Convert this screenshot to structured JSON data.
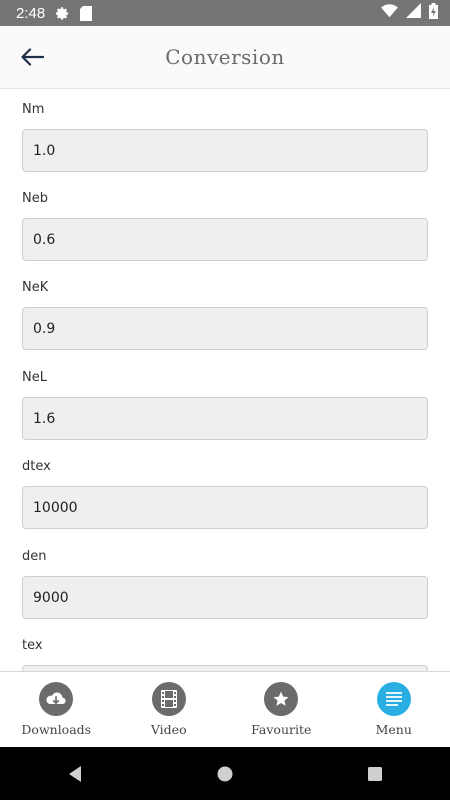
{
  "status_bar": {
    "time": "2:48",
    "icons": [
      "settings-gear-icon",
      "sd-card-icon",
      "wifi-icon",
      "signal-icon",
      "battery-charging-icon"
    ]
  },
  "header": {
    "title": "Conversion",
    "back_icon": "arrow-left-icon"
  },
  "fields": [
    {
      "label": "Nm",
      "value": "1.0"
    },
    {
      "label": "Neb",
      "value": "0.6"
    },
    {
      "label": "NeK",
      "value": "0.9"
    },
    {
      "label": "NeL",
      "value": "1.6"
    },
    {
      "label": "dtex",
      "value": "10000"
    },
    {
      "label": "den",
      "value": "9000"
    },
    {
      "label": "tex",
      "value": ""
    }
  ],
  "bottom_nav": {
    "items": [
      {
        "label": "Downloads",
        "icon": "cloud-download-icon"
      },
      {
        "label": "Video",
        "icon": "film-icon"
      },
      {
        "label": "Favourite",
        "icon": "star-icon"
      },
      {
        "label": "Menu",
        "icon": "menu-lines-icon",
        "active": true
      }
    ],
    "active_color": "#29aee4",
    "inactive_color": "#6b6b6b"
  },
  "system_nav": [
    "back-triangle-icon",
    "home-circle-icon",
    "recents-square-icon"
  ]
}
